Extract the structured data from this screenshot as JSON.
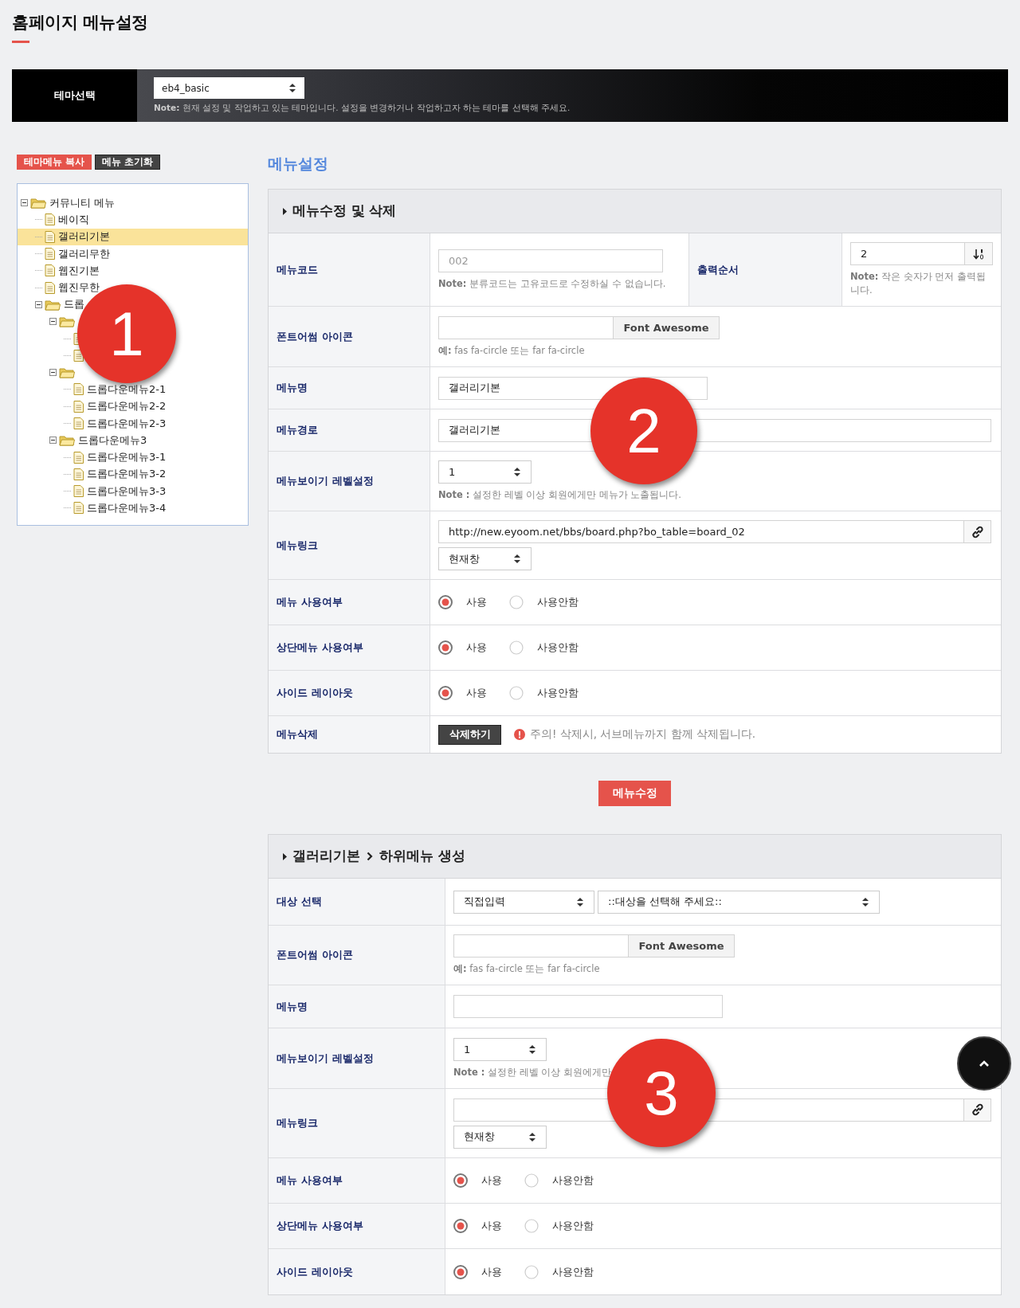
{
  "page_title": "홈페이지 메뉴설정",
  "theme_bar": {
    "label": "테마선택",
    "select": "eb4_basic",
    "note": "**Note:** 현재 설정 및 작업하고 있는 테마입니다. 설정을 변경하거나 작업하고자 하는 테마를 선택해 주세요."
  },
  "tree_buttons": [
    {
      "label": "테마메뉴 복사",
      "kind": "primary"
    },
    {
      "label": "메뉴 초기화",
      "kind": "dark"
    }
  ],
  "tree": [
    {
      "label": "커뮤니티 메뉴",
      "kind": "folder",
      "expanded": true,
      "selected": false,
      "children": [
        {
          "label": "베이직",
          "kind": "page",
          "selected": false
        },
        {
          "label": "갤러리기본",
          "kind": "page",
          "selected": true
        },
        {
          "label": "갤러리무한",
          "kind": "page",
          "selected": false
        },
        {
          "label": "웹진기본",
          "kind": "page",
          "selected": false
        },
        {
          "label": "웹진무한",
          "kind": "page",
          "selected": false
        },
        {
          "label": "드롭",
          "kind": "folder",
          "expanded": true,
          "selected": false,
          "children": [
            {
              "kind": "folder",
              "expanded": true,
              "selected": false,
              "children": [
                {
                  "kind": "page",
                  "selected": false
                },
                {
                  "kind": "page",
                  "selected": false
                }
              ]
            },
            {
              "kind": "folder",
              "expanded": true,
              "selected": false,
              "children": [
                {
                  "label": "드롭다운메뉴2-1",
                  "kind": "page",
                  "selected": false
                },
                {
                  "label": "드롭다운메뉴2-2",
                  "kind": "page",
                  "selected": false
                },
                {
                  "label": "드롭다운메뉴2-3",
                  "kind": "page",
                  "selected": false
                }
              ]
            },
            {
              "label": "드롭다운메뉴3",
              "kind": "folder",
              "expanded": true,
              "selected": false,
              "children": [
                {
                  "label": "드롭다운메뉴3-1",
                  "kind": "page",
                  "selected": false
                },
                {
                  "label": "드롭다운메뉴3-2",
                  "kind": "page",
                  "selected": false
                },
                {
                  "label": "드롭다운메뉴3-3",
                  "kind": "page",
                  "selected": false
                },
                {
                  "label": "드롭다운메뉴3-4",
                  "kind": "page",
                  "selected": false
                }
              ]
            }
          ]
        }
      ]
    }
  ],
  "section_heading": "메뉴설정",
  "edit_panel": {
    "title": "메뉴수정 및 삭제",
    "rows": [
      {
        "kind": "code_order",
        "label": "메뉴코드",
        "value": "002",
        "note": "**Note:** 분류코드는 고유코드로 수정하실 수 없습니다.",
        "order_label": "출력순서",
        "order_value": "2",
        "order_note": "**Note:** 작은 숫자가 먼저 출력됩니다."
      },
      {
        "kind": "icon_input",
        "label": "폰트어썸 아이콘",
        "button": "Font Awesome",
        "note": "**예:** fas fa-circle 또는 far fa-circle"
      },
      {
        "kind": "text",
        "label": "메뉴명",
        "value": "갤러리기본"
      },
      {
        "kind": "path",
        "label": "메뉴경로",
        "value": "갤러리기본"
      },
      {
        "kind": "select_note",
        "label": "메뉴보이기 레벨설정",
        "select": "1",
        "note": "**Note :** 설정한 레벨 이상 회원에게만 메뉴가 노출됩니다."
      },
      {
        "kind": "link",
        "label": "메뉴링크",
        "value": "http://new.eyoom.net/bbs/board.php?bo_table=board_02",
        "target": "현재창"
      },
      {
        "kind": "radio",
        "label": "메뉴 사용여부",
        "options": [
          {
            "label": "사용",
            "selected": true
          },
          {
            "label": "사용안함",
            "selected": false
          }
        ]
      },
      {
        "kind": "radio",
        "label": "상단메뉴 사용여부",
        "options": [
          {
            "label": "사용",
            "selected": true
          },
          {
            "label": "사용안함",
            "selected": false
          }
        ]
      },
      {
        "kind": "radio",
        "label": "사이드 레이아웃",
        "options": [
          {
            "label": "사용",
            "selected": true
          },
          {
            "label": "사용안함",
            "selected": false
          }
        ]
      },
      {
        "kind": "delete",
        "label": "메뉴삭제",
        "button": "삭제하기",
        "warning": "주의! 삭제시, 서브메뉴까지 함께 삭제됩니다."
      }
    ]
  },
  "submit_button": "메뉴수정",
  "create_panel": {
    "parent": "갤러리기본",
    "title": "하위메뉴 생성",
    "rows": [
      {
        "kind": "target_select",
        "label": "대상 선택",
        "selects": [
          "직접입력",
          "::대상을 선택해 주세요::"
        ]
      },
      {
        "kind": "icon_input",
        "label": "폰트어썸 아이콘",
        "button": "Font Awesome",
        "note": "**예:** fas fa-circle 또는 far fa-circle"
      },
      {
        "kind": "text",
        "label": "메뉴명"
      },
      {
        "kind": "select_note",
        "label": "메뉴보이기 레벨설정",
        "select": "1",
        "note": "**Note :** 설정한 레벨 이상 회원에게만"
      },
      {
        "kind": "link",
        "label": "메뉴링크",
        "target": "현재창"
      },
      {
        "kind": "radio",
        "label": "메뉴 사용여부",
        "options": [
          {
            "label": "사용",
            "selected": true
          },
          {
            "label": "사용안함",
            "selected": false
          }
        ]
      },
      {
        "kind": "radio",
        "label": "상단메뉴 사용여부",
        "options": [
          {
            "label": "사용",
            "selected": true
          },
          {
            "label": "사용안함",
            "selected": false
          }
        ]
      },
      {
        "kind": "radio",
        "label": "사이드 레이아웃",
        "options": [
          {
            "label": "사용",
            "selected": true
          },
          {
            "label": "사용안함",
            "selected": false
          }
        ]
      }
    ]
  },
  "annotations": [
    {
      "label": "1"
    },
    {
      "label": "2"
    },
    {
      "label": "3"
    }
  ]
}
